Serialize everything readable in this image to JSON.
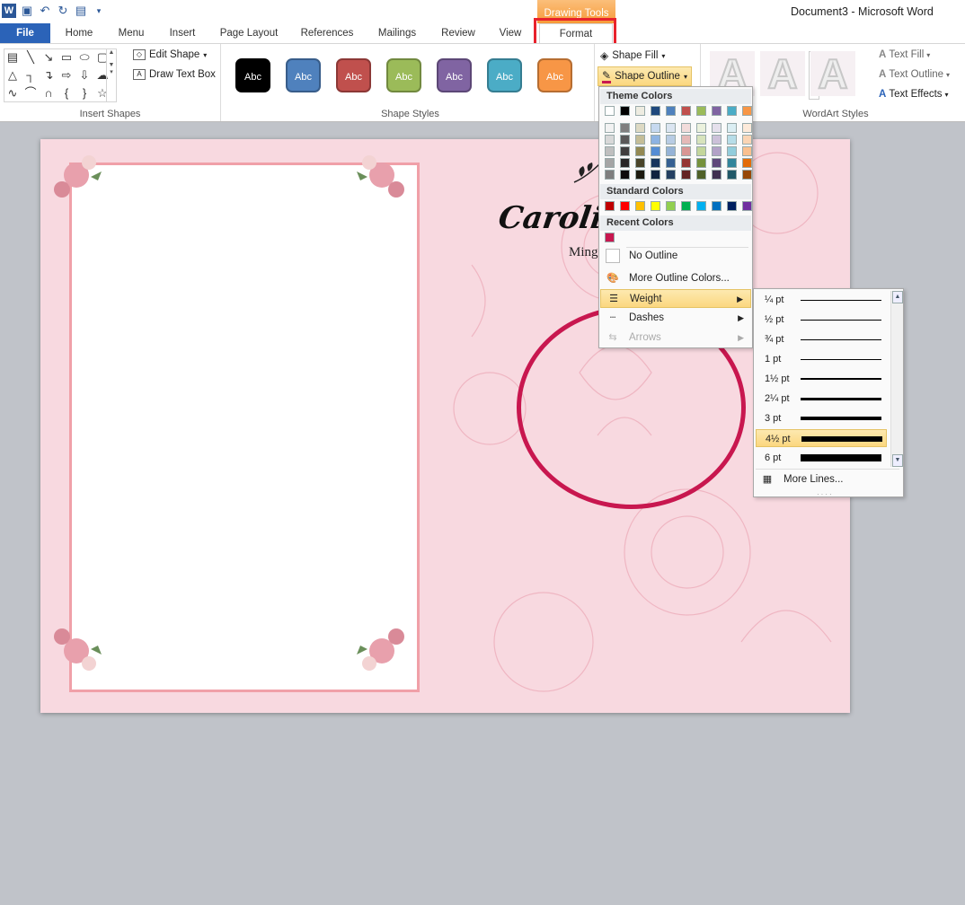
{
  "window": {
    "title": "Document3 - Microsoft Word"
  },
  "contextual": {
    "label": "Drawing Tools"
  },
  "tabs": [
    {
      "label": "File"
    },
    {
      "label": "Home"
    },
    {
      "label": "Menu"
    },
    {
      "label": "Insert"
    },
    {
      "label": "Page Layout"
    },
    {
      "label": "References"
    },
    {
      "label": "Mailings"
    },
    {
      "label": "Review"
    },
    {
      "label": "View"
    },
    {
      "label": "Format"
    }
  ],
  "ribbon": {
    "insert_shapes": {
      "label": "Insert Shapes",
      "edit_shape": "Edit Shape",
      "draw_text_box": "Draw Text Box"
    },
    "shape_styles": {
      "label": "Shape Styles",
      "sample": "Abc",
      "swatches": [
        {
          "fill": "#000000",
          "border": "#000000"
        },
        {
          "fill": "#4f81bd",
          "border": "#385d8a"
        },
        {
          "fill": "#c0504d",
          "border": "#8c3836"
        },
        {
          "fill": "#9bbb59",
          "border": "#71893f"
        },
        {
          "fill": "#8064a2",
          "border": "#5c4776"
        },
        {
          "fill": "#4bacc6",
          "border": "#357d91"
        },
        {
          "fill": "#f79646",
          "border": "#b66d31"
        }
      ]
    },
    "shape_fill": "Shape Fill",
    "shape_outline": "Shape Outline",
    "wordart": {
      "label": "WordArt Styles",
      "letter": "A",
      "text_fill": "Text Fill",
      "text_outline": "Text Outline",
      "text_effects": "Text Effects"
    }
  },
  "document": {
    "name_text": "Carolin",
    "subtitle_text": "Ming"
  },
  "outline_menu": {
    "theme_header": "Theme Colors",
    "theme_top": [
      "#ffffff",
      "#000000",
      "#eeece1",
      "#1f497d",
      "#4f81bd",
      "#c0504d",
      "#9bbb59",
      "#8064a2",
      "#4bacc6",
      "#f79646"
    ],
    "theme_shades": [
      [
        "#f2f2f2",
        "#7f7f7f",
        "#ddd9c3",
        "#c6d9f0",
        "#dbe5f1",
        "#f2dcdb",
        "#ebf1dd",
        "#e5e0ec",
        "#dbeef3",
        "#fdeada"
      ],
      [
        "#d8d8d8",
        "#595959",
        "#c4bd97",
        "#8db3e2",
        "#b8cce4",
        "#e5b9b7",
        "#d7e3bc",
        "#ccc1d9",
        "#b7dde8",
        "#fbd5b5"
      ],
      [
        "#bfbfbf",
        "#3f3f3f",
        "#938953",
        "#548dd4",
        "#95b3d7",
        "#d99694",
        "#c3d69b",
        "#b2a2c7",
        "#92cddc",
        "#fac08f"
      ],
      [
        "#a5a5a5",
        "#262626",
        "#494429",
        "#17365d",
        "#366092",
        "#953734",
        "#76923c",
        "#5f497a",
        "#31859b",
        "#e36c09"
      ],
      [
        "#7f7f7f",
        "#0c0c0c",
        "#1d1b10",
        "#0f243e",
        "#244061",
        "#632423",
        "#4f6128",
        "#3f3151",
        "#205867",
        "#974806"
      ]
    ],
    "standard_header": "Standard Colors",
    "standard": [
      "#c00000",
      "#ff0000",
      "#ffc000",
      "#ffff00",
      "#92d050",
      "#00b050",
      "#00b0f0",
      "#0070c0",
      "#002060",
      "#7030a0"
    ],
    "recent_header": "Recent Colors",
    "recent": [
      "#c8174f"
    ],
    "no_outline": "No Outline",
    "more_colors": "More Outline Colors...",
    "weight": "Weight",
    "dashes": "Dashes",
    "arrows": "Arrows"
  },
  "weight_menu": {
    "items": [
      {
        "label": "¼ pt",
        "weight_pt": 0.25
      },
      {
        "label": "½ pt",
        "weight_pt": 0.5
      },
      {
        "label": "¾ pt",
        "weight_pt": 0.75
      },
      {
        "label": "1 pt",
        "weight_pt": 1
      },
      {
        "label": "1½ pt",
        "weight_pt": 1.5
      },
      {
        "label": "2¼ pt",
        "weight_pt": 2.25
      },
      {
        "label": "3 pt",
        "weight_pt": 3
      },
      {
        "label": "4½ pt",
        "weight_pt": 4.5
      },
      {
        "label": "6 pt",
        "weight_pt": 6
      }
    ],
    "selected_index": 7,
    "more_lines": "More Lines..."
  },
  "colors": {
    "accent_blue": "#2b63b8",
    "highlight_red": "#e8222c",
    "circle": "#c8174f",
    "page_pink": "#f8d9e0"
  }
}
